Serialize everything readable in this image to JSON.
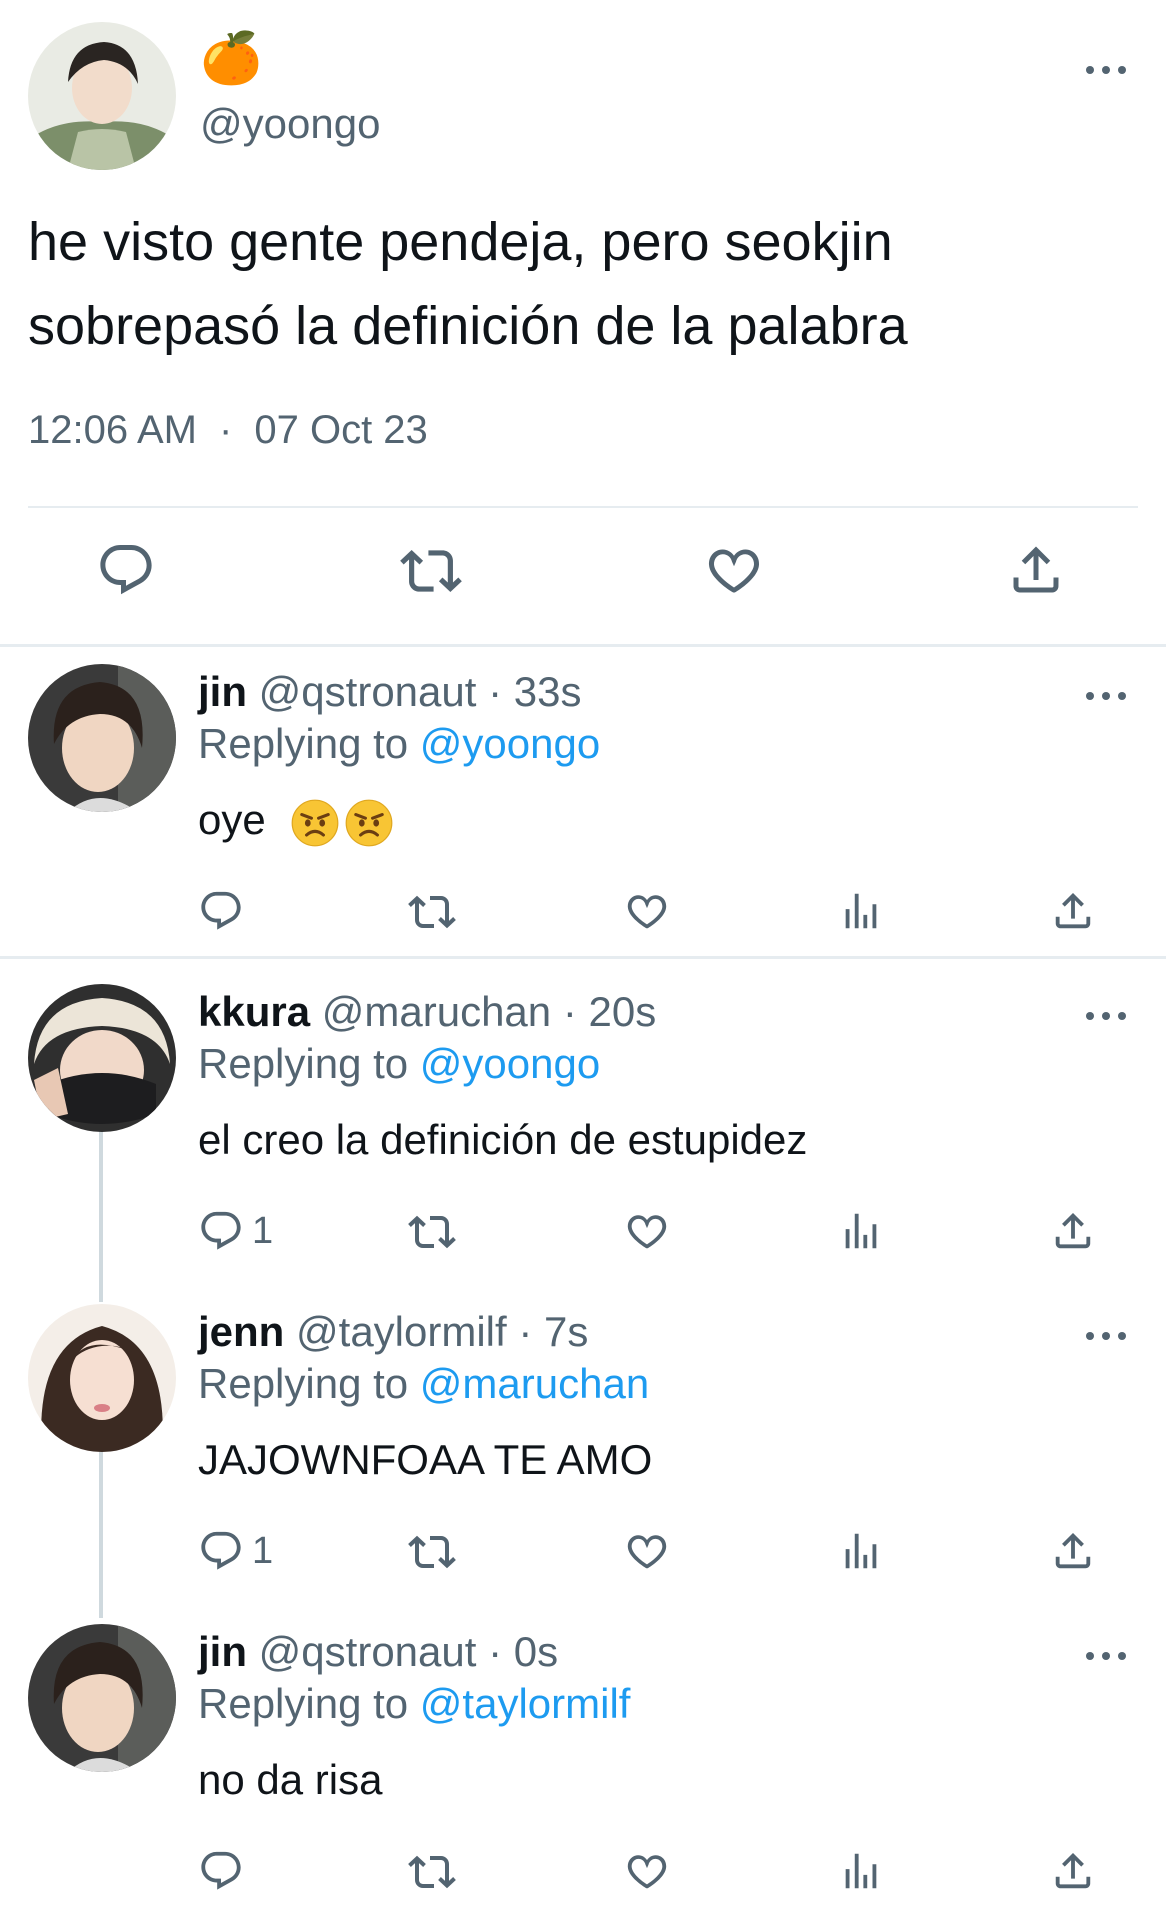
{
  "main": {
    "name_emoji": "🍊",
    "handle": "@yoongo",
    "text": "he visto gente pendeja, pero seokjin\nsobrepasó la definición de la palabra",
    "time": "12:06 AM",
    "dot": "·",
    "date": "07 Oct 23"
  },
  "replies": [
    {
      "name": "jin",
      "handle": "@qstronaut · 33s",
      "replying_prefix": "Replying to ",
      "replying_to": "@yoongo",
      "text": "oye",
      "reply_count": ""
    },
    {
      "name": "kkura",
      "handle": "@maruchan · 20s",
      "replying_prefix": "Replying to ",
      "replying_to": "@yoongo",
      "text": "el creo la definición de estupidez",
      "reply_count": "1"
    },
    {
      "name": "jenn",
      "handle": "@taylormilf · 7s",
      "replying_prefix": "Replying to ",
      "replying_to": "@maruchan",
      "text": "JAJOWNFOAA TE AMO",
      "reply_count": "1"
    },
    {
      "name": "jin",
      "handle": "@qstronaut · 0s",
      "replying_prefix": "Replying to ",
      "replying_to": "@taylormilf",
      "text": "no da risa",
      "reply_count": ""
    }
  ],
  "icons": {
    "reply": "reply-icon",
    "retweet": "retweet-icon",
    "like": "heart-icon",
    "views": "views-icon",
    "share": "share-icon",
    "more": "more-icon",
    "angry": "angry-face-icon"
  },
  "colors": {
    "text": "#0f1419",
    "secondary": "#536471",
    "link": "#1d9bf0",
    "divider": "#e6ecf0"
  }
}
